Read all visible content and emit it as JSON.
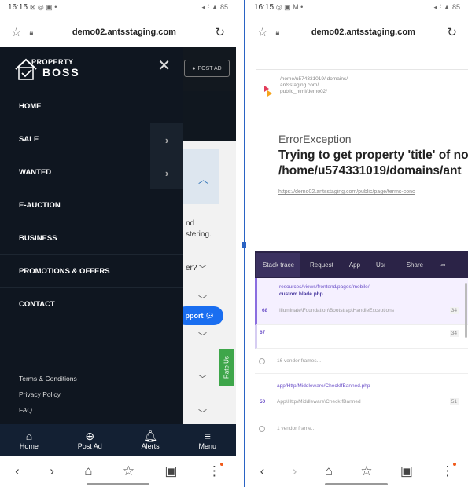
{
  "left": {
    "status": {
      "time": "16:15",
      "icons": "⊠ ◎ ▣ •",
      "right_icons": "◂ ⁞ ▲ 85"
    },
    "url": "demo02.antsstaging.com",
    "post_ad": "POST AD",
    "logo": {
      "line1": "PROPERTY",
      "line2": "BOSS"
    },
    "menu": [
      {
        "label": "HOME",
        "has_submenu": false
      },
      {
        "label": "SALE",
        "has_submenu": true
      },
      {
        "label": "WANTED",
        "has_submenu": true
      },
      {
        "label": "E-AUCTION",
        "has_submenu": false
      },
      {
        "label": "BUSINESS",
        "has_submenu": false
      },
      {
        "label": "PROMOTIONS & OFFERS",
        "has_submenu": false
      },
      {
        "label": "CONTACT",
        "has_submenu": false
      }
    ],
    "footer_links": [
      "Terms & Conditions",
      "Privacy Policy",
      "FAQ"
    ],
    "peek": {
      "line1": "nd",
      "line2": "stering.",
      "line3": "er?",
      "support": "pport",
      "rate": "Rate Us"
    },
    "appbar": [
      {
        "icon": "home-icon",
        "label": "Home"
      },
      {
        "icon": "plus-circle-icon",
        "label": "Post Ad"
      },
      {
        "icon": "bell-icon",
        "label": "Alerts"
      },
      {
        "icon": "hamburger-icon",
        "label": "Menu"
      }
    ]
  },
  "right": {
    "status": {
      "time": "16:15",
      "icons": "◎ ▣ M •",
      "right_icons": "◂ ⁞ ▲ 85"
    },
    "url": "demo02.antsstaging.com",
    "error_path": "/home/u574331019/ domains/ antsstaging.com/ public_html/demo02/",
    "exception": "ErrorException",
    "message_line1": "Trying to get property 'title' of nor",
    "message_line2": "/home/u574331019/domains/ant",
    "error_url": "https://demo02.antsstaging.com/public/page/terms-conc",
    "tabs": [
      "Stack trace",
      "Request",
      "App",
      "Usı",
      "Share"
    ],
    "frames": [
      {
        "num": "68",
        "file1": "resources/views/frontend/pages/mobile/",
        "file2": "custom.blade.php",
        "class": "Illuminate\\Foundation\\Bootstrap\\HandleExceptions",
        "line": "34"
      },
      {
        "num": "67",
        "line": "34"
      },
      {
        "vendor": "16 vendor frames..."
      },
      {
        "num": "50",
        "file1": "app/Http/Middleware/CheckIfBanned.php",
        "class": "App\\Http\\Middleware\\CheckIfBanned",
        "line": "51"
      },
      {
        "vendor": "1 vendor frame..."
      }
    ]
  }
}
